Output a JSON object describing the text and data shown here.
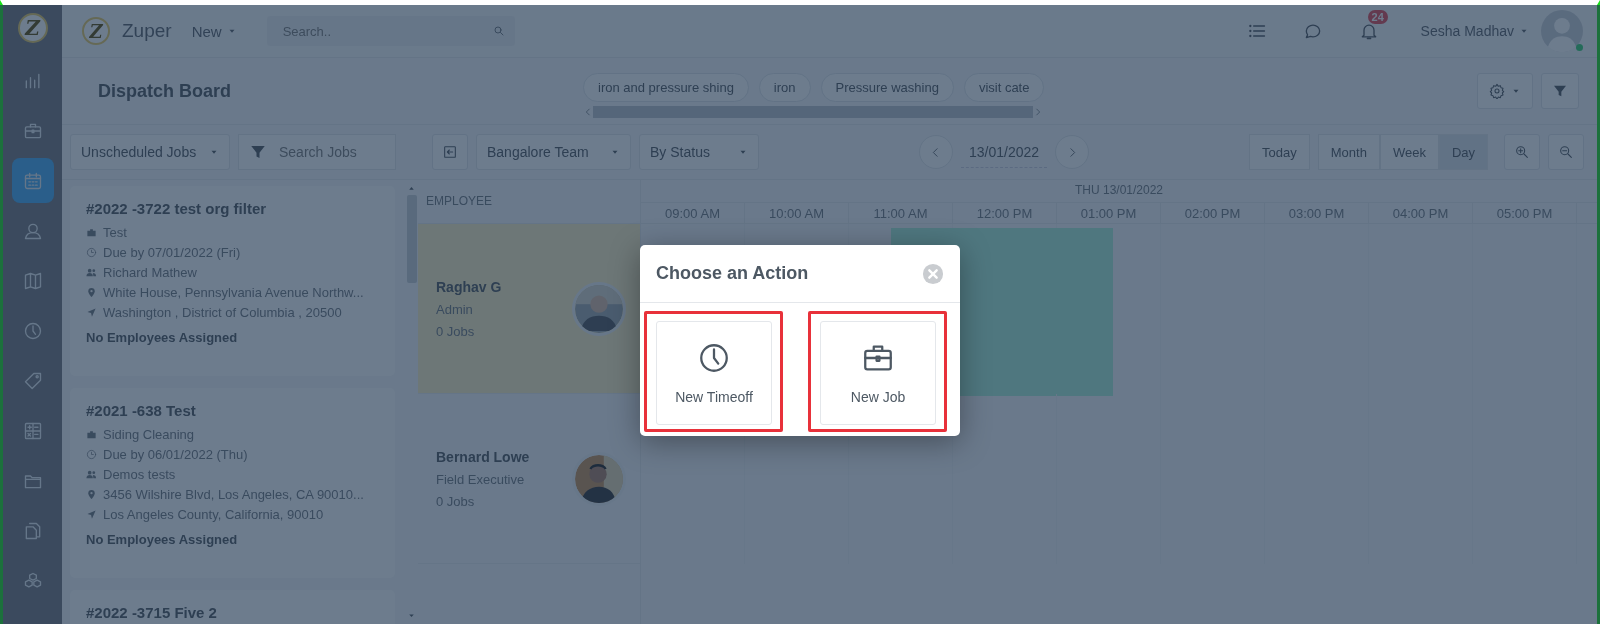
{
  "sidebar": {
    "logo_letter": "Z",
    "items": [
      {
        "selected": false
      },
      {
        "selected": false
      },
      {
        "selected": true
      },
      {
        "selected": false
      },
      {
        "selected": false
      },
      {
        "selected": false
      },
      {
        "selected": false
      },
      {
        "selected": false
      },
      {
        "selected": false
      },
      {
        "selected": false
      },
      {
        "selected": false
      }
    ]
  },
  "topbar": {
    "logo_letter": "Z",
    "brand": "Zuper",
    "new_menu": "New",
    "search": {
      "placeholder": "Search.."
    },
    "notification_count": "24",
    "user_name": "Sesha Madhav",
    "user_online": true
  },
  "header": {
    "title": "Dispatch Board",
    "tags": [
      "iron and pressure shing",
      "iron",
      "Pressure washing",
      "visit cate"
    ]
  },
  "toolbar": {
    "job_filter": "Unscheduled Jobs",
    "job_search": {
      "placeholder": "Search Jobs"
    },
    "team": "Bangalore Team",
    "grouping": "By Status",
    "date": "13/01/2022",
    "views": [
      {
        "label": "Today",
        "selected": false
      },
      {
        "label": "Month",
        "selected": false
      },
      {
        "label": "Week",
        "selected": false
      },
      {
        "label": "Day",
        "selected": true
      }
    ]
  },
  "jobs": [
    {
      "title": "#2022 -3722 test org filter",
      "lines": [
        {
          "kind": "type",
          "text": "Test"
        },
        {
          "kind": "due",
          "text": "Due by 07/01/2022 (Fri)"
        },
        {
          "kind": "customer",
          "text": "Richard Mathew"
        },
        {
          "kind": "address",
          "text": "White House, Pennsylvania Avenue Northw..."
        },
        {
          "kind": "city",
          "text": "Washington , District of Columbia , 20500"
        }
      ],
      "assignment": "No Employees Assigned"
    },
    {
      "title": "#2021 -638 Test",
      "lines": [
        {
          "kind": "type",
          "text": "Siding Cleaning"
        },
        {
          "kind": "due",
          "text": "Due by 06/01/2022 (Thu)"
        },
        {
          "kind": "customer",
          "text": "Demos tests"
        },
        {
          "kind": "address",
          "text": "3456 Wilshire Blvd, Los Angeles, CA 90010..."
        },
        {
          "kind": "city",
          "text": "Los Angeles County, California, 90010"
        }
      ],
      "assignment": "No Employees Assigned"
    },
    {
      "title": "#2022 -3715 Five 2"
    }
  ],
  "schedule": {
    "employee_heading": "EMPLOYEE",
    "day": "THU 13/01/2022",
    "hours": [
      "09:00 AM",
      "10:00 AM",
      "11:00 AM",
      "12:00 PM",
      "01:00 PM",
      "02:00 PM",
      "03:00 PM",
      "04:00 PM",
      "05:00 PM"
    ],
    "employees": [
      {
        "name": "Raghav G",
        "role": "Admin",
        "jobs": "0 Jobs",
        "highlighted": true,
        "has_event": true
      },
      {
        "name": "Bernard Lowe",
        "role": "Field Executive",
        "jobs": "0 Jobs",
        "highlighted": false,
        "has_event": false
      }
    ]
  },
  "dialog": {
    "title": "Choose an Action",
    "actions": [
      {
        "label": "New Timeoff",
        "highlighted": true
      },
      {
        "label": "New Job",
        "highlighted": true
      }
    ]
  }
}
